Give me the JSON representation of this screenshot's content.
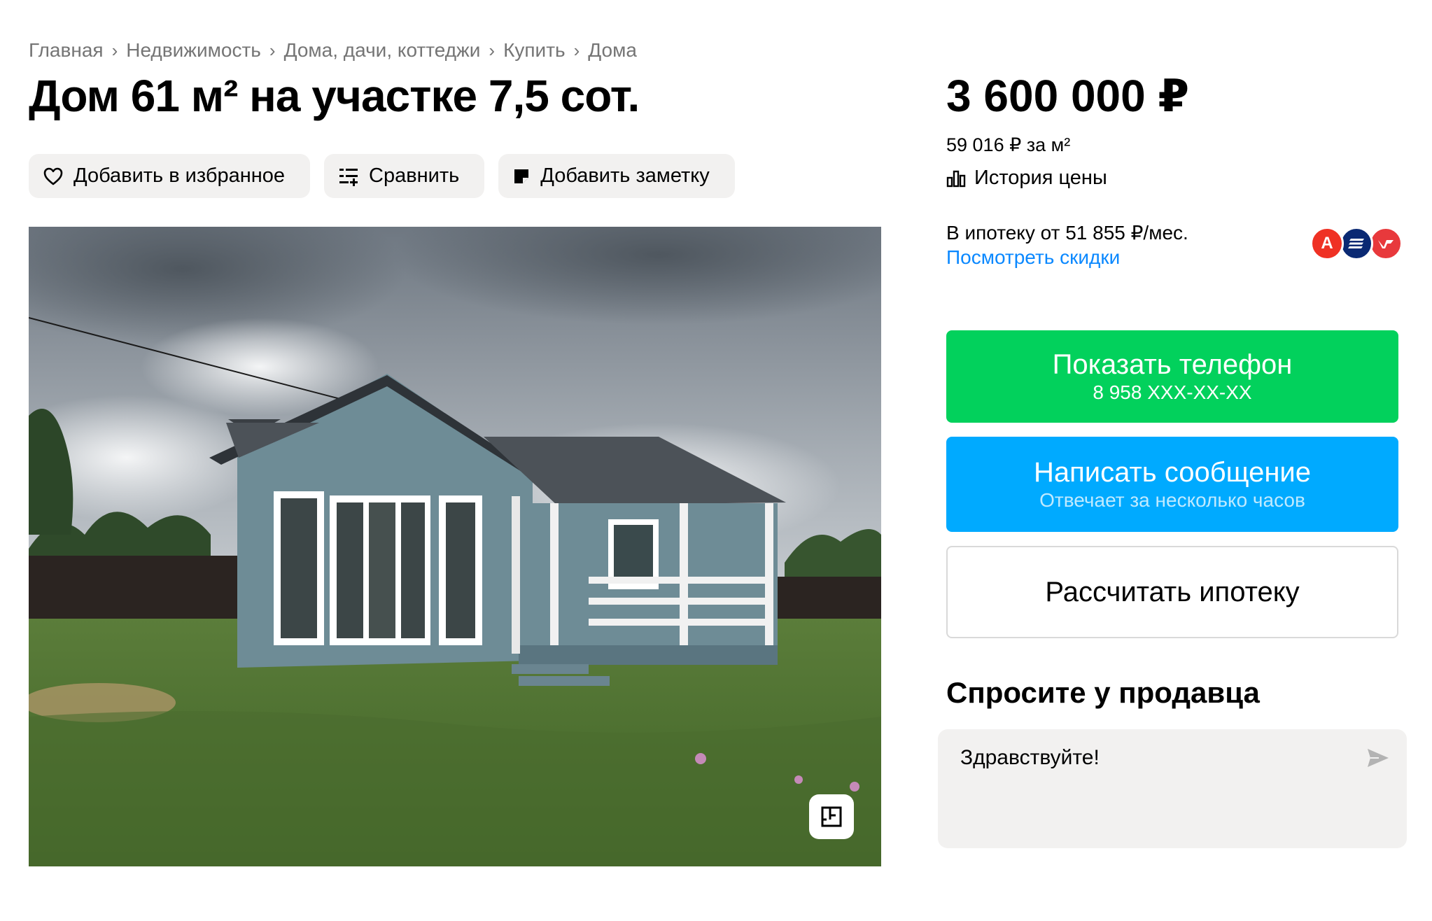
{
  "breadcrumb": [
    "Главная",
    "Недвижимость",
    "Дома, дачи, коттеджи",
    "Купить",
    "Дома"
  ],
  "title": "Дом 61 м² на участке 7,5 сот.",
  "actions": {
    "favorite": "Добавить в избранное",
    "compare": "Сравнить",
    "note": "Добавить заметку"
  },
  "price": {
    "total": "3 600 000 ₽",
    "per_m2": "59 016 ₽ за м²",
    "history": "История цены"
  },
  "mortgage": {
    "text": "В ипотеку от 51 855 ₽/мес.",
    "discount_link": "Посмотреть скидки",
    "banks": [
      "alfa-bank-icon",
      "vtb-icon",
      "psb-icon"
    ],
    "bank_letters": {
      "alfa": "А"
    }
  },
  "contact": {
    "phone_label": "Показать телефон",
    "phone_number": "8 958 XXX-XX-XX",
    "message_label": "Написать сообщение",
    "message_sub": "Отвечает за несколько часов",
    "mortgage_calc": "Рассчитать ипотеку"
  },
  "ask_seller": {
    "title": "Спросите у продавца",
    "message_value": "Здравствуйте!"
  },
  "colors": {
    "phone_button": "#02d15c",
    "message_button": "#00aaff",
    "link": "#0a88ff",
    "action_bg": "#f2f1f0"
  }
}
